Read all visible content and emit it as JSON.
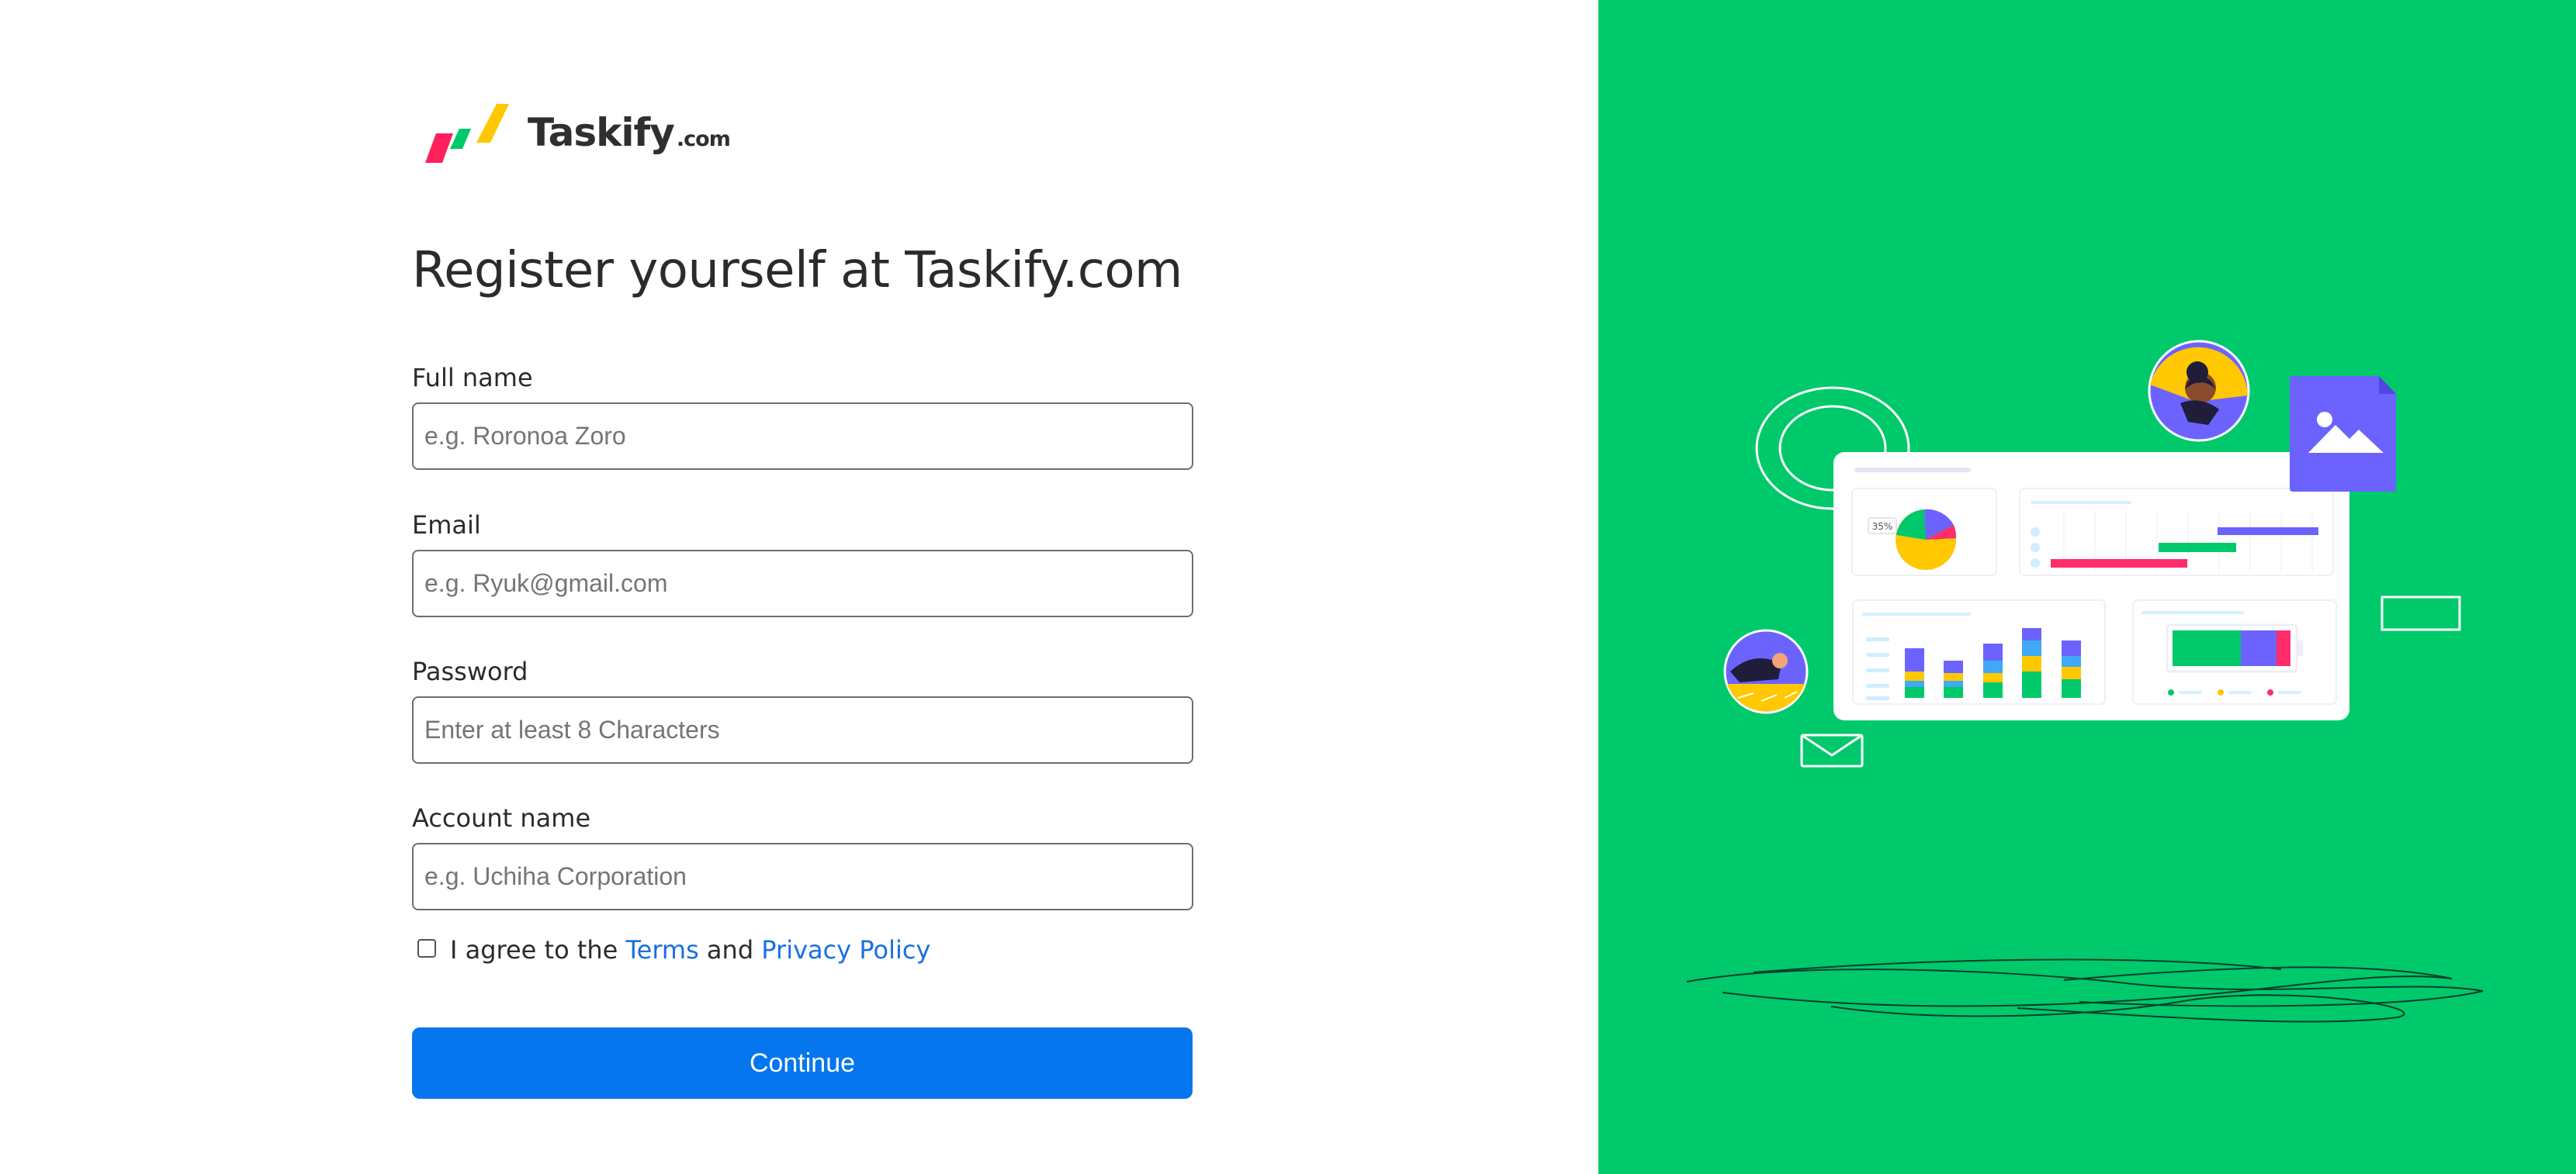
{
  "brand": {
    "name": "Taskify",
    "suffix": ".com",
    "logo_colors": [
      "#ff1f5a",
      "#00c96b",
      "#ffc800"
    ]
  },
  "page": {
    "title": "Register yourself at Taskify.com"
  },
  "form": {
    "fields": [
      {
        "label": "Full name",
        "placeholder": "e.g. Roronoa Zoro",
        "value": ""
      },
      {
        "label": "Email",
        "placeholder": "e.g. Ryuk@gmail.com",
        "value": ""
      },
      {
        "label": "Password",
        "placeholder": "Enter at least 8 Characters",
        "value": ""
      },
      {
        "label": "Account name",
        "placeholder": "e.g. Uchiha Corporation",
        "value": ""
      }
    ],
    "agree": {
      "prefix": "I agree to the",
      "terms_link": "Terms",
      "conjunction": "and",
      "privacy_link": "Privacy Policy",
      "checked": false
    },
    "submit_label": "Continue"
  },
  "illustration": {
    "background_color": "#00c96b",
    "pie_badge": "35%",
    "palette": {
      "purple": "#6c63ff",
      "green": "#00c96b",
      "yellow": "#ffc800",
      "pink": "#ff2d6b",
      "blue": "#3fa9f5"
    }
  },
  "colors": {
    "accent": "#0676ef",
    "link": "#1a6fe0",
    "text": "#2b2b2b"
  }
}
